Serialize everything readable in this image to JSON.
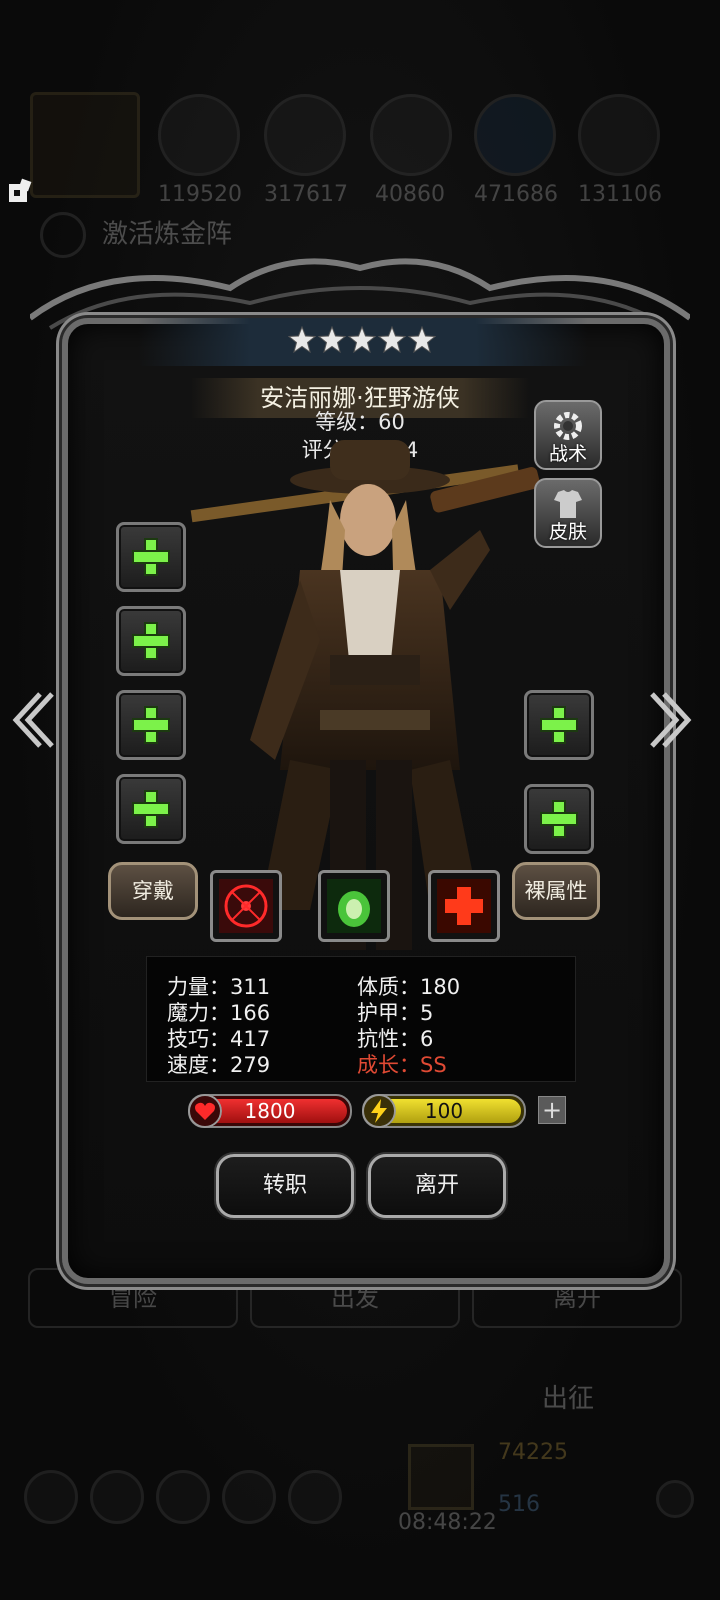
{
  "background": {
    "resources": [
      "119520",
      "317617",
      "40860",
      "471686",
      "131106"
    ],
    "alchemy_label": "激活炼金阵",
    "tabs": [
      "冒险",
      "出发",
      "离开"
    ],
    "deploy_label": "出征",
    "clock": "08:48:22",
    "gold": "74225",
    "gems": "516"
  },
  "hero": {
    "stars": 5,
    "name": "安洁丽娜·狂野游侠",
    "level_text": "等级：60",
    "score_text": "评分：1804"
  },
  "side_buttons": {
    "tactics": "战术",
    "skin": "皮肤"
  },
  "action_buttons": {
    "equip": "穿戴",
    "base_attributes": "裸属性"
  },
  "stats": {
    "strength": "力量：311",
    "magic": "魔力：166",
    "skill": "技巧：417",
    "speed": "速度：279",
    "constitution": "体质：180",
    "armor": "护甲：5",
    "resistance": "抗性：6",
    "growth": "成长：SS"
  },
  "bars": {
    "hp": "1800",
    "energy": "100"
  },
  "buttons": {
    "change_class": "转职",
    "leave": "离开"
  },
  "colors": {
    "accent_green": "#7cf24a",
    "growth_red": "#e04a34",
    "hp_red": "#d01a1a",
    "energy_yellow": "#d6c11a"
  }
}
